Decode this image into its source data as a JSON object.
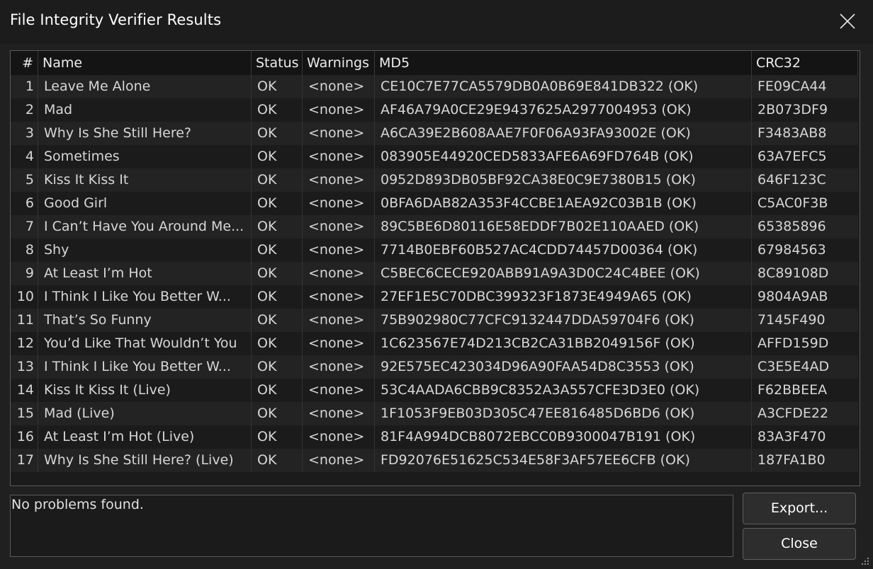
{
  "window": {
    "title": "File Integrity Verifier Results"
  },
  "table": {
    "headers": {
      "num": "#",
      "name": "Name",
      "status": "Status",
      "warnings": "Warnings",
      "md5": "MD5",
      "crc32": "CRC32"
    },
    "rows": [
      {
        "num": "1",
        "name": "Leave Me Alone",
        "status": "OK",
        "warnings": "<none>",
        "md5": "CE10C7E77CA5579DB0A0B69E841DB322 (OK)",
        "crc32": "FE09CA44"
      },
      {
        "num": "2",
        "name": "Mad",
        "status": "OK",
        "warnings": "<none>",
        "md5": "AF46A79A0CE29E9437625A2977004953 (OK)",
        "crc32": "2B073DF9"
      },
      {
        "num": "3",
        "name": "Why Is She Still Here?",
        "status": "OK",
        "warnings": "<none>",
        "md5": "A6CA39E2B608AAE7F0F06A93FA93002E (OK)",
        "crc32": "F3483AB8"
      },
      {
        "num": "4",
        "name": "Sometimes",
        "status": "OK",
        "warnings": "<none>",
        "md5": "083905E44920CED5833AFE6A69FD764B (OK)",
        "crc32": "63A7EFC5"
      },
      {
        "num": "5",
        "name": "Kiss It Kiss It",
        "status": "OK",
        "warnings": "<none>",
        "md5": "0952D893DB05BF92CA38E0C9E7380B15 (OK)",
        "crc32": "646F123C"
      },
      {
        "num": "6",
        "name": "Good Girl",
        "status": "OK",
        "warnings": "<none>",
        "md5": "0BFA6DAB82A353F4CCBE1AEA92C03B1B (OK)",
        "crc32": "C5AC0F3B"
      },
      {
        "num": "7",
        "name": "I Can’t Have You Around Me...",
        "status": "OK",
        "warnings": "<none>",
        "md5": "89C5BE6D80116E58EDDF7B02E110AAED (OK)",
        "crc32": "65385896"
      },
      {
        "num": "8",
        "name": "Shy",
        "status": "OK",
        "warnings": "<none>",
        "md5": "7714B0EBF60B527AC4CDD74457D00364 (OK)",
        "crc32": "67984563"
      },
      {
        "num": "9",
        "name": "At Least I’m Hot",
        "status": "OK",
        "warnings": "<none>",
        "md5": "C5BEC6CECE920ABB91A9A3D0C24C4BEE (OK)",
        "crc32": "8C89108D"
      },
      {
        "num": "10",
        "name": "I Think I Like You Better W...",
        "status": "OK",
        "warnings": "<none>",
        "md5": "27EF1E5C70DBC399323F1873E4949A65 (OK)",
        "crc32": "9804A9AB"
      },
      {
        "num": "11",
        "name": "That’s So Funny",
        "status": "OK",
        "warnings": "<none>",
        "md5": "75B902980C77CFC9132447DDA59704F6 (OK)",
        "crc32": "7145F490"
      },
      {
        "num": "12",
        "name": "You’d Like That Wouldn’t You",
        "status": "OK",
        "warnings": "<none>",
        "md5": "1C623567E74D213CB2CA31BB2049156F (OK)",
        "crc32": "AFFD159D"
      },
      {
        "num": "13",
        "name": "I Think I Like You Better W...",
        "status": "OK",
        "warnings": "<none>",
        "md5": "92E575EC423034D96A90FAA54D8C3553 (OK)",
        "crc32": "C3E5E4AD"
      },
      {
        "num": "14",
        "name": "Kiss It Kiss It (Live)",
        "status": "OK",
        "warnings": "<none>",
        "md5": "53C4AADA6CBB9C8352A3A557CFE3D3E0 (OK)",
        "crc32": "F62BBEEA"
      },
      {
        "num": "15",
        "name": "Mad (Live)",
        "status": "OK",
        "warnings": "<none>",
        "md5": "1F1053F9EB03D305C47EE816485D6BD6 (OK)",
        "crc32": "A3CFDE22"
      },
      {
        "num": "16",
        "name": "At Least I’m Hot (Live)",
        "status": "OK",
        "warnings": "<none>",
        "md5": "81F4A994DCB8072EBCC0B9300047B191 (OK)",
        "crc32": "83A3F470"
      },
      {
        "num": "17",
        "name": "Why Is She Still Here? (Live)",
        "status": "OK",
        "warnings": "<none>",
        "md5": "FD92076E51625C534E58F3AF57EE6CFB (OK)",
        "crc32": "187FA1B0"
      }
    ]
  },
  "message": {
    "text": "No problems found."
  },
  "buttons": {
    "export_label": "Export...",
    "close_label": "Close"
  },
  "icons": {
    "close": "close-icon",
    "resize": "resize-grip-icon"
  },
  "colors": {
    "background": "#202020",
    "text": "#d6d6d6",
    "border": "#5a5a5a"
  }
}
